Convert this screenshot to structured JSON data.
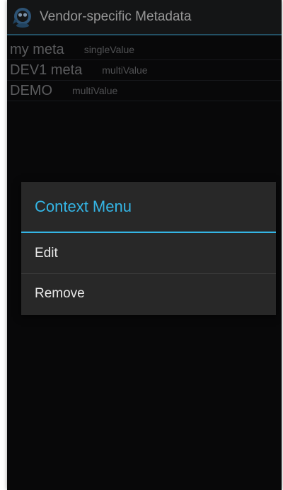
{
  "app_bar": {
    "icon": "app-logo-icon",
    "title": "Vendor-specific Metadata"
  },
  "metadata_list": [
    {
      "name": "my meta",
      "type": "singleValue"
    },
    {
      "name": "DEV1 meta",
      "type": "multiValue"
    },
    {
      "name": "DEMO",
      "type": "multiValue"
    }
  ],
  "context_menu": {
    "title": "Context Menu",
    "items": [
      {
        "label": "Edit"
      },
      {
        "label": "Remove"
      }
    ]
  },
  "colors": {
    "accent": "#34b5e5",
    "background": "#0b0b0d",
    "dialog_background": "#282828"
  }
}
